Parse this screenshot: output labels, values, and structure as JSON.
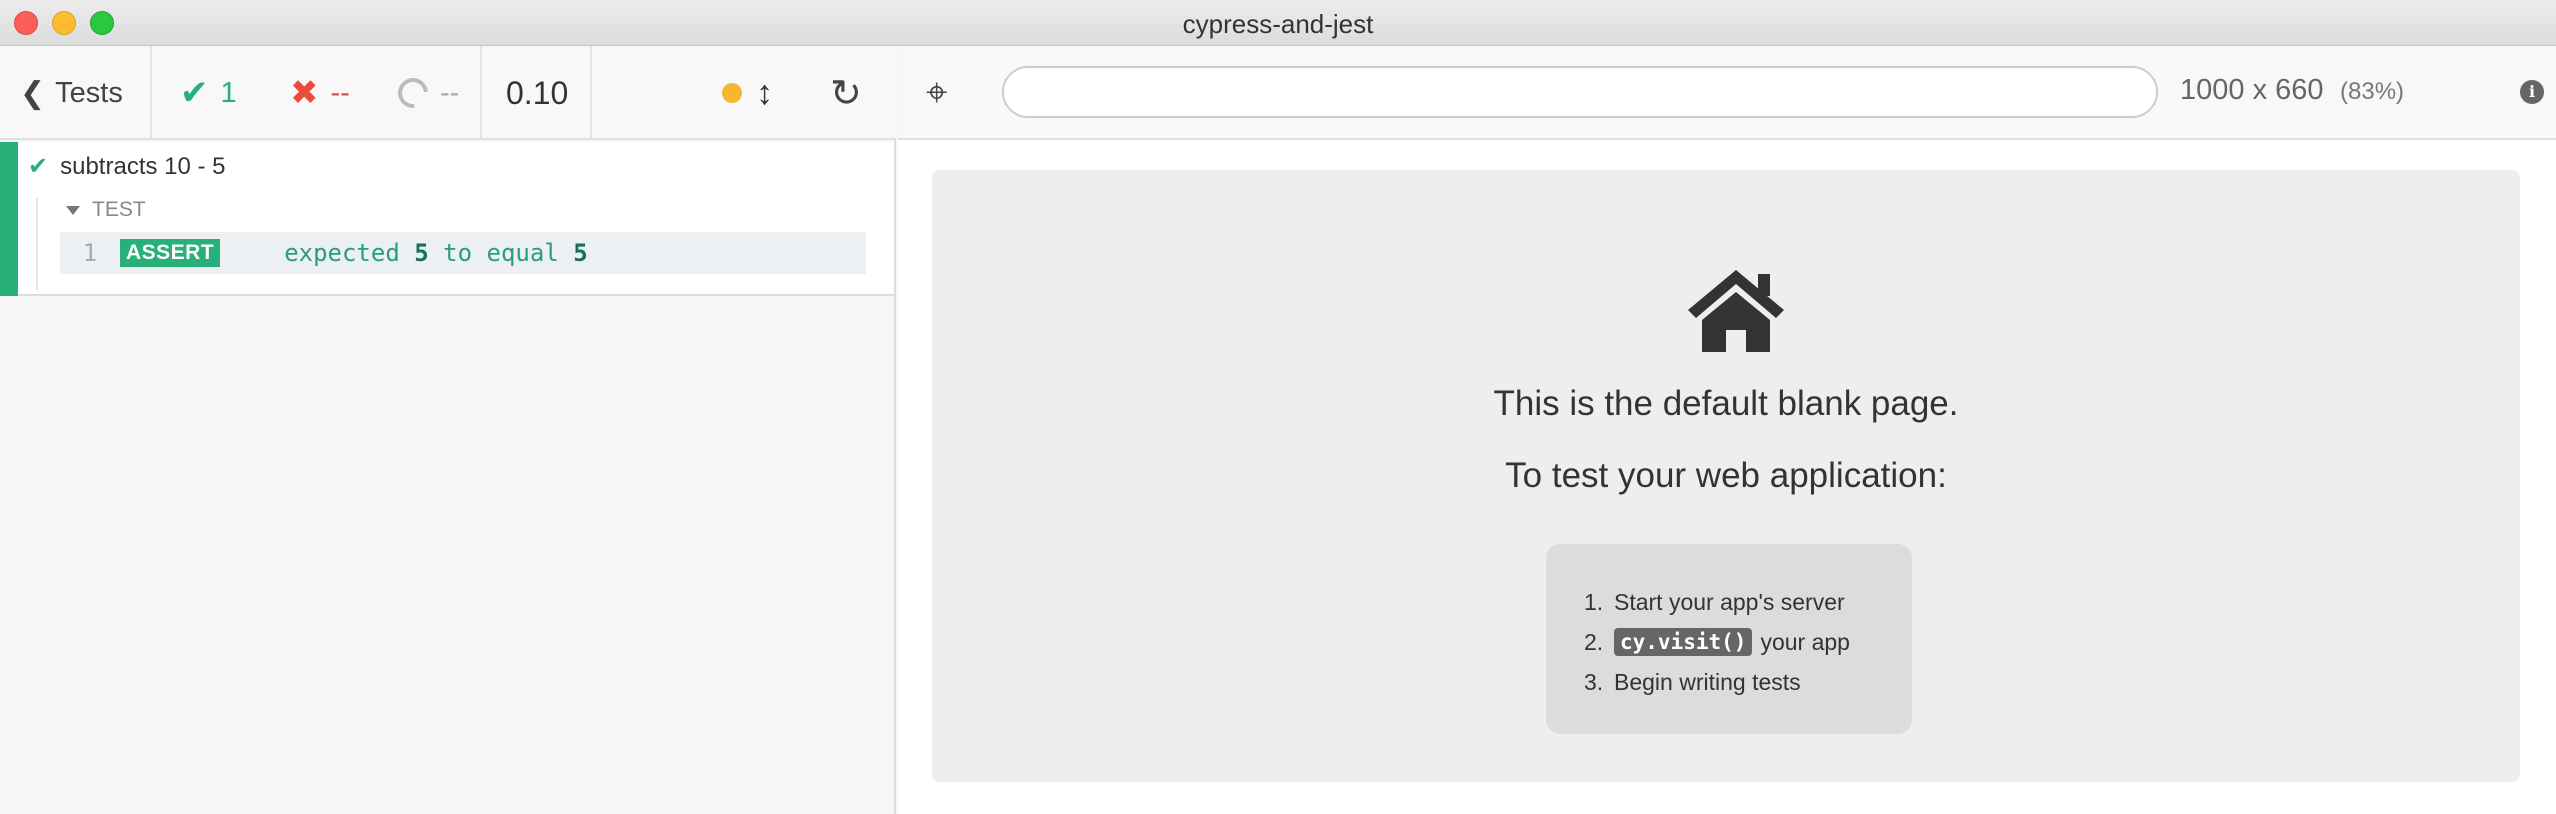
{
  "window": {
    "title": "cypress-and-jest",
    "controls": [
      "close",
      "minimize",
      "maximize"
    ]
  },
  "reporter": {
    "back_label": "Tests",
    "stats": {
      "passed": "1",
      "failed": "--",
      "pending": "--"
    },
    "duration": "0.10",
    "status_dot_color": "#f5b731",
    "reload_icon": "reload-icon"
  },
  "test": {
    "title": "subtracts 10 - 5",
    "state": "passed",
    "hook_label": "TEST",
    "commands": [
      {
        "number": "1",
        "name": "ASSERT",
        "message": {
          "p1": "expected",
          "v1": "5",
          "p2": "to equal",
          "v2": "5"
        }
      }
    ]
  },
  "aut": {
    "url_value": "",
    "viewport_size": "1000 x 660",
    "viewport_scale": "(83%)",
    "blank_page": {
      "line1": "This is the default blank page.",
      "line2": "To test your web application:",
      "steps": [
        {
          "num": "1.",
          "text": "Start your app's server"
        },
        {
          "num": "2.",
          "code": "cy.visit()",
          "text": "your app"
        },
        {
          "num": "3.",
          "text": "Begin writing tests"
        }
      ]
    }
  },
  "colors": {
    "pass": "#27b07a",
    "fail": "#e94b3c",
    "pending": "#aaaaaa"
  }
}
